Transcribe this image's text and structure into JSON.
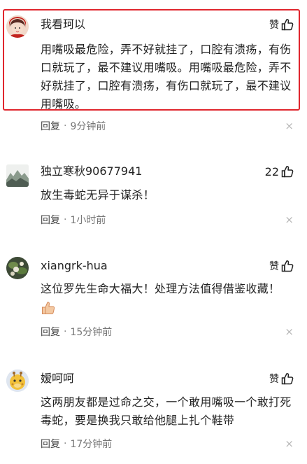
{
  "comments": [
    {
      "username": "我看珂以",
      "like_label": "赞",
      "like_count": "",
      "text": "用嘴吸最危险，弄不好就挂了，口腔有溃疡，有伤口就玩了，最不建议用嘴吸。用嘴吸最危险，弄不好就挂了，口腔有溃疡，有伤口就玩了，最不建议用嘴吸。",
      "reply_label": "回复",
      "time": "9分钟前",
      "close": "×",
      "avatar_icon": "girl-avatar-icon"
    },
    {
      "username": "独立寒秋90677941",
      "like_label": "",
      "like_count": "22",
      "text": "放生毒蛇无异于谋杀！",
      "reply_label": "回复",
      "time": "1小时前",
      "close": "×",
      "avatar_icon": "landscape-avatar-icon"
    },
    {
      "username": "xiangrk-hua",
      "like_label": "赞",
      "like_count": "",
      "text": "这位罗先生命大福大！处理方法值得借鉴收藏！",
      "reply_label": "回复",
      "time": "15分钟前",
      "close": "×",
      "avatar_icon": "flower-avatar-icon",
      "emoji_icon": "thumbs-up-emoji-icon"
    },
    {
      "username": "嫒呵呵",
      "like_label": "赞",
      "like_count": "",
      "text": "这两朋友都是过命之交，一个敢用嘴吸一个敢打死毒蛇，要是换我只敢给他腿上扎个鞋带",
      "reply_label": "回复",
      "time": "17分钟前",
      "close": "×",
      "avatar_icon": "giraffe-avatar-icon"
    }
  ],
  "colors": {
    "highlight_border": "#e0262e",
    "meta_text": "#777777",
    "close_icon": "#b8b8b8"
  }
}
